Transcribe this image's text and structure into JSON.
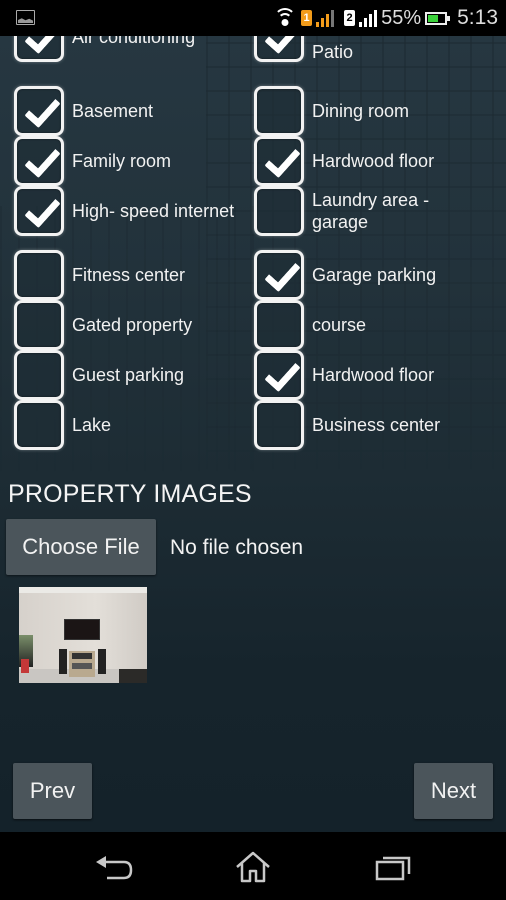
{
  "status_bar": {
    "notification_icon": "gallery-icon",
    "wifi_icon": "wifi-icon",
    "sim1_label": "1",
    "sim2_label": "2",
    "battery_percent": "55%",
    "battery_level": 0.55,
    "time": "5:13",
    "colors": {
      "sim1": "#f39c1a",
      "battery_fill": "#3cd23c"
    }
  },
  "amenities": {
    "items": [
      {
        "label": "Air conditioning",
        "checked": true,
        "column": "left"
      },
      {
        "label": "Patio",
        "checked": true,
        "column": "right",
        "partially_hidden": true
      },
      {
        "label": "Basement",
        "checked": true,
        "column": "left"
      },
      {
        "label": "Dining room",
        "checked": false,
        "column": "right"
      },
      {
        "label": "Family room",
        "checked": true,
        "column": "left"
      },
      {
        "label": "Hardwood floor",
        "checked": true,
        "column": "right"
      },
      {
        "label": "High- speed internet",
        "checked": true,
        "column": "left"
      },
      {
        "label": "Laundry area - garage",
        "checked": false,
        "column": "right"
      },
      {
        "label": "Fitness center",
        "checked": false,
        "column": "left"
      },
      {
        "label": "Garage parking",
        "checked": true,
        "column": "right"
      },
      {
        "label": "Gated property",
        "checked": false,
        "column": "left"
      },
      {
        "label": " course",
        "checked": false,
        "column": "right"
      },
      {
        "label": "Guest parking",
        "checked": false,
        "column": "left"
      },
      {
        "label": "Hardwood floor",
        "checked": true,
        "column": "right"
      },
      {
        "label": "Lake",
        "checked": false,
        "column": "left"
      },
      {
        "label": "Business center",
        "checked": false,
        "column": "right"
      }
    ]
  },
  "property_images": {
    "title": "PROPERTY IMAGES",
    "choose_file_label": "Choose File",
    "file_status": "No file chosen",
    "thumbnail_description": "living room with TV and speakers"
  },
  "navigation": {
    "prev_label": "Prev",
    "next_label": "Next"
  },
  "system_nav": {
    "back_icon": "back-icon",
    "home_icon": "home-icon",
    "recents_icon": "recent-apps-icon"
  },
  "colors": {
    "background": "#1d2c34",
    "button": "#4b555b",
    "text": "#f2f2f2"
  }
}
